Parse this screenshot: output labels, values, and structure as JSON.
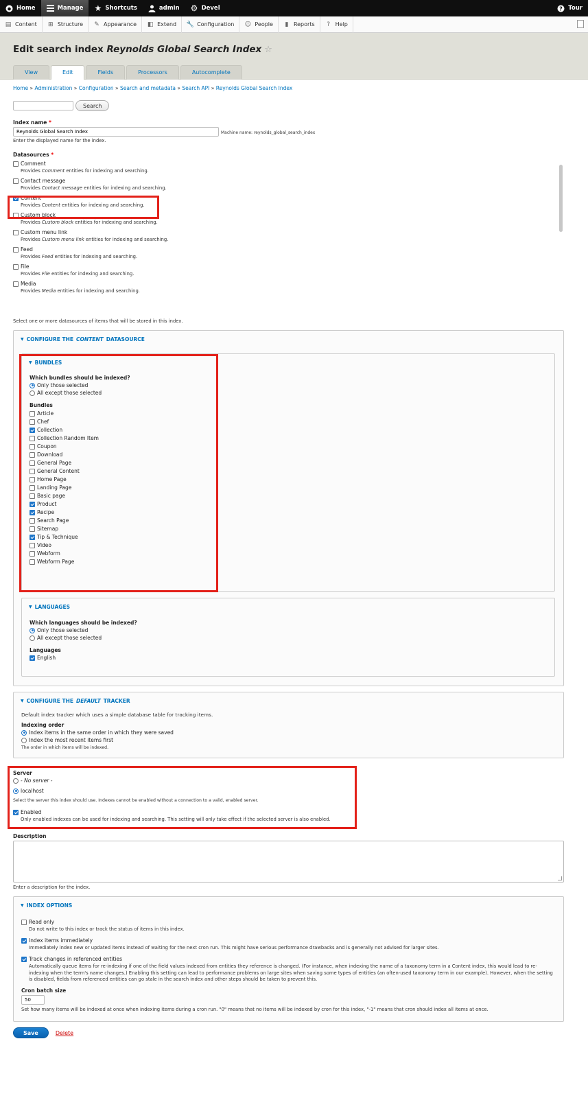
{
  "toolbar": {
    "items": [
      {
        "label": "Home",
        "icon": "drupal-icon"
      },
      {
        "label": "Manage",
        "icon": "menu-icon"
      },
      {
        "label": "Shortcuts",
        "icon": "star-icon"
      },
      {
        "label": "admin",
        "icon": "user-icon"
      },
      {
        "label": "Devel",
        "icon": "gear-icon"
      }
    ],
    "tour": "Tour"
  },
  "tray": {
    "items": [
      {
        "label": "Content",
        "icon": "file-icon"
      },
      {
        "label": "Structure",
        "icon": "sitemap-icon"
      },
      {
        "label": "Appearance",
        "icon": "paintbrush-icon"
      },
      {
        "label": "Extend",
        "icon": "puzzle-icon"
      },
      {
        "label": "Configuration",
        "icon": "wrench-icon"
      },
      {
        "label": "People",
        "icon": "people-icon"
      },
      {
        "label": "Reports",
        "icon": "bar-chart-icon"
      },
      {
        "label": "Help",
        "icon": "help-icon"
      }
    ]
  },
  "header": {
    "title_prefix": "Edit search index",
    "title_name": "Reynolds Global Search Index",
    "tabs": [
      "View",
      "Edit",
      "Fields",
      "Processors",
      "Autocomplete"
    ]
  },
  "breadcrumb": [
    "Home",
    "Administration",
    "Configuration",
    "Search and metadata",
    "Search API",
    "Reynolds Global Search Index"
  ],
  "search": {
    "button": "Search",
    "value": ""
  },
  "index_name": {
    "label": "Index name",
    "value": "Reynolds Global Search Index",
    "machine_name": "Machine name: reynolds_global_search_index",
    "description": "Enter the displayed name for the index."
  },
  "datasources": {
    "label": "Datasources",
    "items": [
      {
        "name": "Comment",
        "desc_pre": "Provides ",
        "desc_em": "Comment",
        "desc_post": " entities for indexing and searching.",
        "checked": false
      },
      {
        "name": "Contact message",
        "desc_pre": "Provides ",
        "desc_em": "Contact message",
        "desc_post": " entities for indexing and searching.",
        "checked": false
      },
      {
        "name": "Content",
        "desc_pre": "Provides ",
        "desc_em": "Content",
        "desc_post": " entities for indexing and searching.",
        "checked": true
      },
      {
        "name": "Custom block",
        "desc_pre": "Provides ",
        "desc_em": "Custom block",
        "desc_post": " entities for indexing and searching.",
        "checked": false
      },
      {
        "name": "Custom menu link",
        "desc_pre": "Provides ",
        "desc_em": "Custom menu link",
        "desc_post": " entities for indexing and searching.",
        "checked": false
      },
      {
        "name": "Feed",
        "desc_pre": "Provides ",
        "desc_em": "Feed",
        "desc_post": " entities for indexing and searching.",
        "checked": false
      },
      {
        "name": "File",
        "desc_pre": "Provides ",
        "desc_em": "File",
        "desc_post": " entities for indexing and searching.",
        "checked": false
      },
      {
        "name": "Media",
        "desc_pre": "Provides ",
        "desc_em": "Media",
        "desc_post": " entities for indexing and searching.",
        "checked": false
      }
    ],
    "description": "Select one or more datasources of items that will be stored in this index."
  },
  "content_ds": {
    "legend_pre": "Configure the",
    "legend_em": "Content",
    "legend_post": "datasource",
    "bundles": {
      "legend": "Bundles",
      "question": "Which bundles should be indexed?",
      "options": [
        {
          "label": "Only those selected",
          "checked": true
        },
        {
          "label": "All except those selected",
          "checked": false
        }
      ],
      "list_label": "Bundles",
      "items": [
        {
          "label": "Article",
          "checked": false
        },
        {
          "label": "Chef",
          "checked": false
        },
        {
          "label": "Collection",
          "checked": true
        },
        {
          "label": "Collection Random Item",
          "checked": false
        },
        {
          "label": "Coupon",
          "checked": false
        },
        {
          "label": "Download",
          "checked": false
        },
        {
          "label": "General Page",
          "checked": false
        },
        {
          "label": "General Content",
          "checked": false
        },
        {
          "label": "Home Page",
          "checked": false
        },
        {
          "label": "Landing Page",
          "checked": false
        },
        {
          "label": "Basic page",
          "checked": false
        },
        {
          "label": "Product",
          "checked": true
        },
        {
          "label": "Recipe",
          "checked": true
        },
        {
          "label": "Search Page",
          "checked": false
        },
        {
          "label": "Sitemap",
          "checked": false
        },
        {
          "label": "Tip & Technique",
          "checked": true
        },
        {
          "label": "Video",
          "checked": false
        },
        {
          "label": "Webform",
          "checked": false
        },
        {
          "label": "Webform Page",
          "checked": false
        }
      ]
    },
    "languages": {
      "legend": "Languages",
      "question": "Which languages should be indexed?",
      "options": [
        {
          "label": "Only those selected",
          "checked": true
        },
        {
          "label": "All except those selected",
          "checked": false
        }
      ],
      "list_label": "Languages",
      "items": [
        {
          "label": "English",
          "checked": true
        }
      ]
    }
  },
  "tracker": {
    "legend_pre": "Configure the",
    "legend_em": "default",
    "legend_post": "tracker",
    "description": "Default index tracker which uses a simple database table for tracking items.",
    "order_label": "Indexing order",
    "options": [
      {
        "label": "Index items in the same order in which they were saved",
        "checked": true
      },
      {
        "label": "Index the most recent items first",
        "checked": false
      }
    ],
    "order_desc": "The order in which items will be indexed."
  },
  "server": {
    "label": "Server",
    "options": [
      {
        "label": "- No server -",
        "checked": false
      },
      {
        "label": "localhost",
        "checked": true
      }
    ],
    "description": "Select the server this index should use. Indexes cannot be enabled without a connection to a valid, enabled server.",
    "enabled_label": "Enabled",
    "enabled_checked": true,
    "enabled_desc": "Only enabled indexes can be used for indexing and searching. This setting will only take effect if the selected server is also enabled."
  },
  "description_field": {
    "label": "Description",
    "value": "",
    "help": "Enter a description for the index."
  },
  "index_options": {
    "legend": "Index options",
    "read_only": {
      "label": "Read only",
      "checked": false,
      "desc": "Do not write to this index or track the status of items in this index."
    },
    "immediately": {
      "label": "Index items immediately",
      "checked": true,
      "desc": "Immediately index new or updated items instead of waiting for the next cron run. This might have serious performance drawbacks and is generally not advised for larger sites."
    },
    "track_changes": {
      "label": "Track changes in referenced entities",
      "checked": true,
      "desc": "Automatically queue items for re-indexing if one of the field values indexed from entities they reference is changed. (For instance, when indexing the name of a taxonomy term in a Content index, this would lead to re-indexing when the term's name changes.) Enabling this setting can lead to performance problems on large sites when saving some types of entities (an often-used taxonomy term in our example). However, when the setting is disabled, fields from referenced entities can go stale in the search index and other steps should be taken to prevent this."
    },
    "cron_label": "Cron batch size",
    "cron_value": "50",
    "cron_desc": "Set how many items will be indexed at once when indexing items during a cron run. \"0\" means that no items will be indexed by cron for this index, \"-1\" means that cron should index all items at once."
  },
  "actions": {
    "save": "Save",
    "delete": "Delete"
  },
  "colors": {
    "accent": "#0074bd",
    "highlight": "#e3211a",
    "checked": "#1f76c9"
  }
}
